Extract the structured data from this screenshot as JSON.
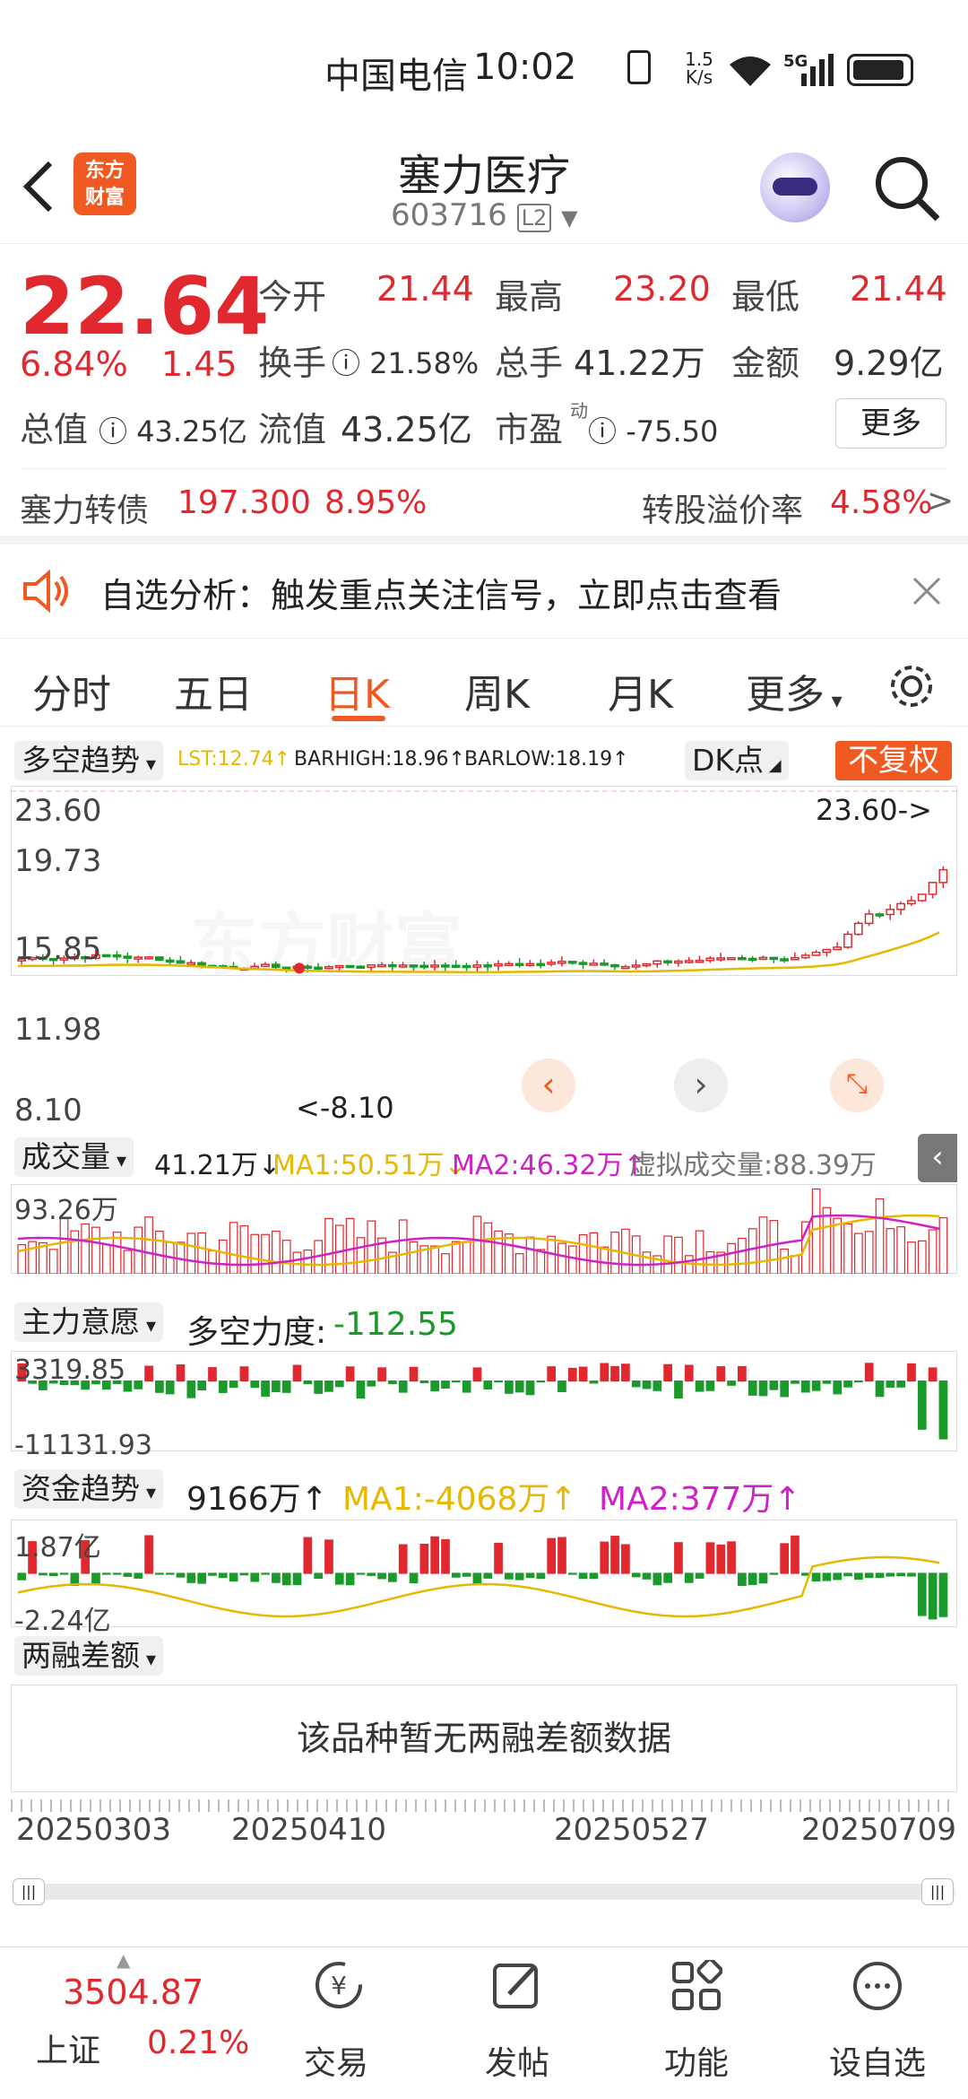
{
  "status": {
    "carrier": "中国电信",
    "time": "10:02",
    "net_speed_top": "1.5",
    "net_speed_bottom": "K/s",
    "net_type": "5G"
  },
  "header": {
    "logo_line1": "东方",
    "logo_line2": "财富",
    "title": "塞力医疗",
    "code": "603716",
    "code_badge": "L2"
  },
  "quote": {
    "price": "22.64",
    "pct": "6.84%",
    "chg": "1.45",
    "open_label": "今开",
    "open": "21.44",
    "high_label": "最高",
    "high": "23.20",
    "low_label": "最低",
    "low": "21.44",
    "turnover_label": "换手",
    "turnover": "21.58%",
    "vol_label": "总手",
    "vol": "41.22万",
    "amount_label": "金额",
    "amount": "9.29亿",
    "mcap_label": "总值",
    "mcap": "43.25亿",
    "float_label": "流值",
    "float": "43.25亿",
    "pe_label": "市盈",
    "pe_sup": "动",
    "pe": "-75.50",
    "more": "更多"
  },
  "bond": {
    "name": "塞力转债",
    "price": "197.300",
    "pct": "8.95%",
    "premium_label": "转股溢价率",
    "premium": "4.58%"
  },
  "notice": {
    "text": "自选分析：触发重点关注信号，立即点击查看"
  },
  "tabs": [
    "分时",
    "五日",
    "日K",
    "周K",
    "月K",
    "更多"
  ],
  "kline": {
    "indicator": "多空趋势",
    "lst": "LST:12.74↑",
    "barhigh": "BARHIGH:18.96↑",
    "barlow": "BARLOW:18.19↑",
    "dk": "DK点",
    "fq": "不复权",
    "y_labels": [
      "23.60",
      "19.73",
      "15.85",
      "11.98",
      "8.10"
    ],
    "max_marker": "23.60->",
    "min_marker": "<-8.10",
    "watermark": "东方财富"
  },
  "volume": {
    "label": "成交量",
    "value": "41.21万↓",
    "ma1": "MA1:50.51万↓",
    "ma2": "MA2:46.32万↑",
    "virtual": "虚拟成交量:88.39万",
    "top": "93.26万"
  },
  "zlyy": {
    "label": "主力意愿",
    "title": "多空力度:",
    "value": "-112.55",
    "top": "3319.85",
    "bottom": "-11131.93"
  },
  "zjqs": {
    "label": "资金趋势",
    "value": "9166万↑",
    "ma1": "MA1:-4068万↑",
    "ma2": "MA2:377万↑",
    "top": "1.87亿",
    "bottom": "-2.24亿"
  },
  "margin": {
    "label": "两融差额",
    "empty": "该品种暂无两融差额数据"
  },
  "dates": [
    "20250303",
    "20250410",
    "20250527",
    "20250709"
  ],
  "index": {
    "value": "3504.87",
    "name": "上证",
    "pct": "0.21%"
  },
  "nav": [
    "交易",
    "发帖",
    "功能",
    "设自选"
  ],
  "colors": {
    "up": "#e0282e",
    "down": "#1a9a2a",
    "accent": "#f05a22",
    "ma_yellow": "#e6b800",
    "ma_magenta": "#d020c8"
  }
}
